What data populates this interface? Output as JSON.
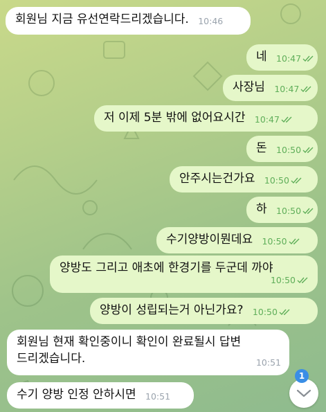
{
  "messages": [
    {
      "dir": "in",
      "text": "회원님 지금 유선연락드리겠습니다.",
      "time": "10:46"
    },
    {
      "dir": "out",
      "text": "네",
      "time": "10:47"
    },
    {
      "dir": "out",
      "text": "사장님",
      "time": "10:47"
    },
    {
      "dir": "out",
      "text": "저 이제 5분 밖에 없어요시간",
      "time": "10:47"
    },
    {
      "dir": "out",
      "text": "돈",
      "time": "10:50"
    },
    {
      "dir": "out",
      "text": "안주시는건가요",
      "time": "10:50"
    },
    {
      "dir": "out",
      "text": "하",
      "time": "10:50"
    },
    {
      "dir": "out",
      "text": "수기양방이뭔데요",
      "time": "10:50"
    },
    {
      "dir": "out",
      "text": "양방도 그리고 애초에 한경기를 두군데 까야",
      "time": "10:50"
    },
    {
      "dir": "out",
      "text": "양방이 성립되는거 아닌가요?",
      "time": "10:50"
    },
    {
      "dir": "in",
      "text_line1": "회원님 현재 확인중이니 확인이 완료될시 답변",
      "text_line2": "드리겠습니다.",
      "time": "10:51"
    },
    {
      "dir": "in",
      "text": "수기 양방 인정 안하시면",
      "time": "10:51"
    }
  ],
  "unread_badge": "1",
  "icons": {
    "scroll": "chevron-down-icon",
    "read": "double-check-icon"
  },
  "colors": {
    "incoming": "#ffffff",
    "outgoing": "#e5f7c9",
    "check": "#5fae59",
    "badge": "#3a8ee6"
  }
}
